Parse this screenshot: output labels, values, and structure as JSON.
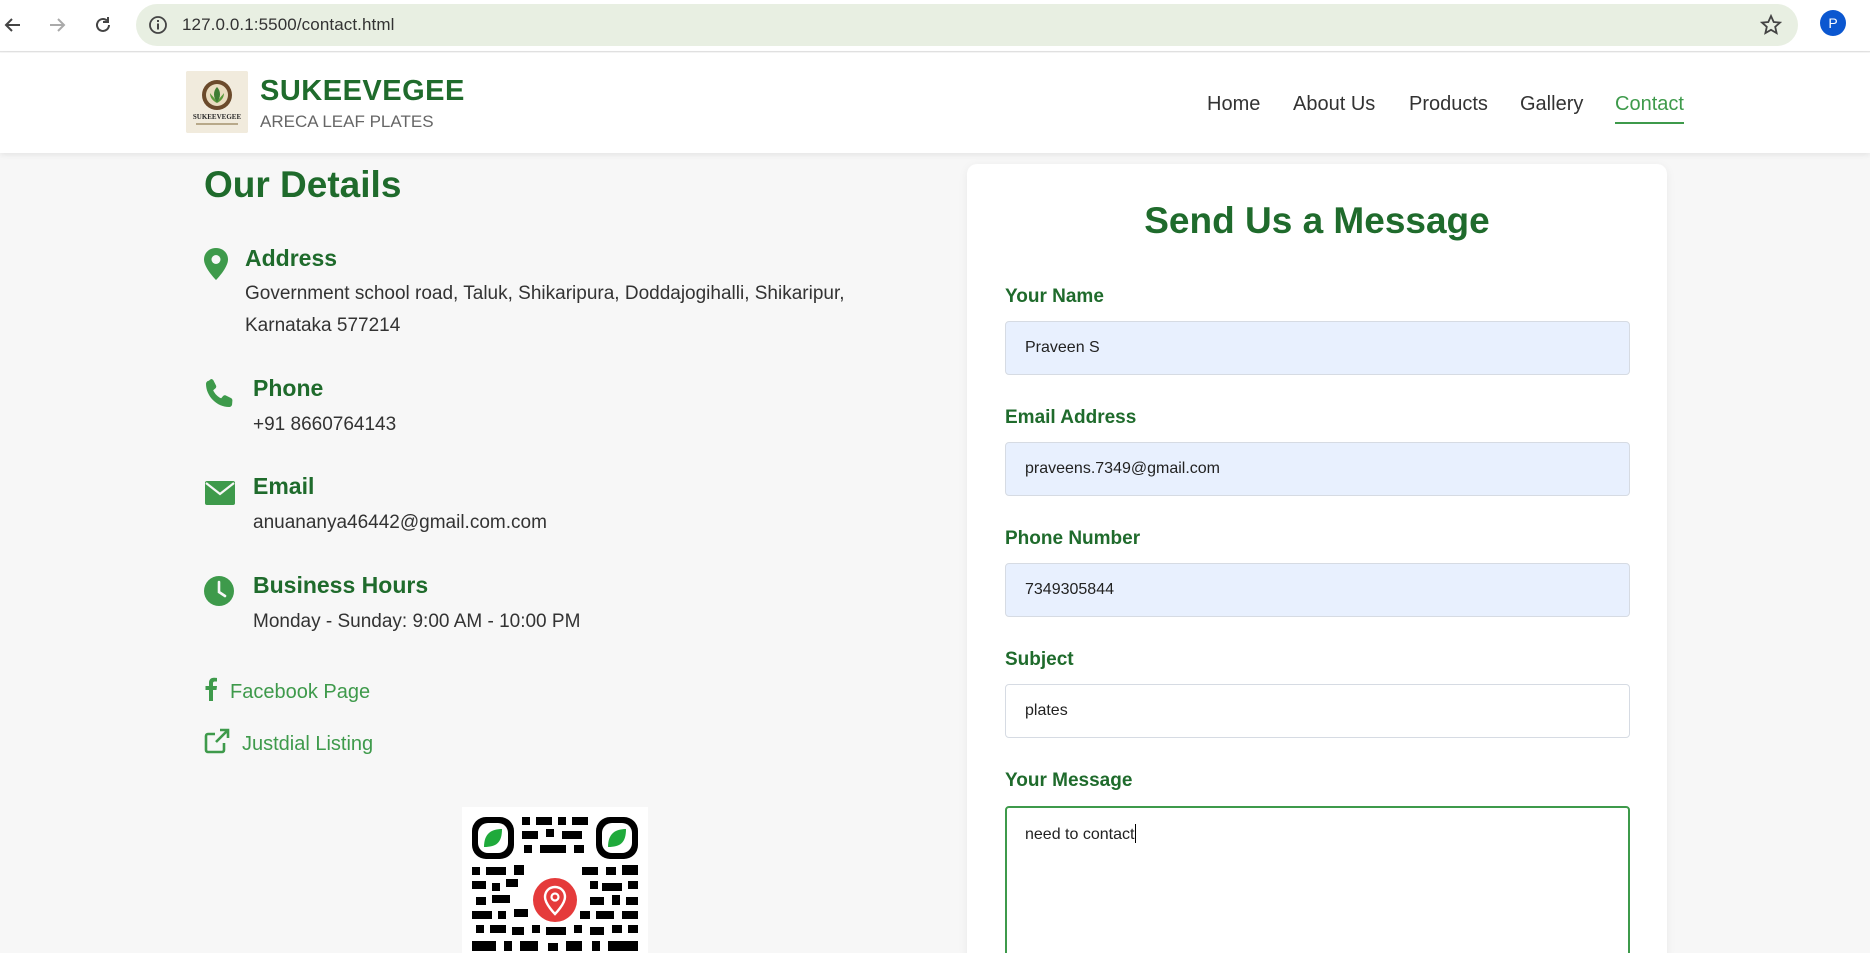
{
  "browser": {
    "url": "127.0.0.1:5500/contact.html",
    "profile_initial": "P"
  },
  "header": {
    "brand_name": "SUKEEVEGEE",
    "brand_sub": "ARECA LEAF PLATES",
    "logo_text": "SUKEEVEGEE",
    "nav": [
      {
        "label": "Home"
      },
      {
        "label": "About Us"
      },
      {
        "label": "Products"
      },
      {
        "label": "Gallery"
      },
      {
        "label": "Contact",
        "active": true
      }
    ]
  },
  "details": {
    "title": "Our Details",
    "address": {
      "heading": "Address",
      "line1": "Government school road, Taluk, Shikaripura, Doddajogihalli, Shikaripur,",
      "line2": "Karnataka 577214"
    },
    "phone": {
      "heading": "Phone",
      "value": "+91 8660764143"
    },
    "email": {
      "heading": "Email",
      "value": "anuananya46442@gmail.com.com"
    },
    "hours": {
      "heading": "Business Hours",
      "value": "Monday - Sunday: 9:00 AM - 10:00 PM"
    },
    "links": [
      {
        "label": "Facebook Page",
        "icon": "facebook-icon"
      },
      {
        "label": "Justdial Listing",
        "icon": "external-link-icon"
      }
    ]
  },
  "form": {
    "title": "Send Us a Message",
    "name_label": "Your Name",
    "name_value": "Praveen S",
    "email_label": "Email Address",
    "email_value": "praveens.7349@gmail.com",
    "phone_label": "Phone Number",
    "phone_value": "7349305844",
    "subject_label": "Subject",
    "subject_value": "plates",
    "message_label": "Your Message",
    "message_value": "need to contact"
  },
  "colors": {
    "brand_green": "#1f6b2c",
    "accent_green": "#3e9a4b",
    "autofill_blue": "#e8f0fe"
  }
}
